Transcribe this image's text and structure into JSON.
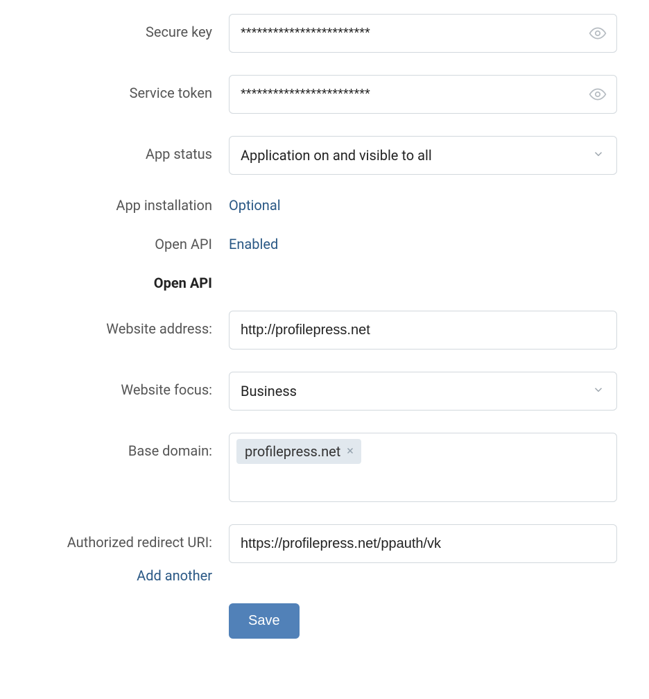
{
  "fields": {
    "secure_key": {
      "label": "Secure key",
      "value": "************************"
    },
    "service_token": {
      "label": "Service token",
      "value": "************************"
    },
    "app_status": {
      "label": "App status",
      "value": "Application on and visible to all"
    },
    "app_installation": {
      "label": "App installation",
      "value": "Optional"
    },
    "open_api_status": {
      "label": "Open API",
      "value": "Enabled"
    }
  },
  "section": {
    "title": "Open API"
  },
  "open_api": {
    "website_address": {
      "label": "Website address:",
      "value": "http://profilepress.net"
    },
    "website_focus": {
      "label": "Website focus:",
      "value": "Business"
    },
    "base_domain": {
      "label": "Base domain:",
      "tag": "profilepress.net"
    },
    "redirect_uri": {
      "label": "Authorized redirect URI:",
      "value": "https://profilepress.net/ppauth/vk",
      "add_another": "Add another"
    }
  },
  "buttons": {
    "save": "Save"
  }
}
